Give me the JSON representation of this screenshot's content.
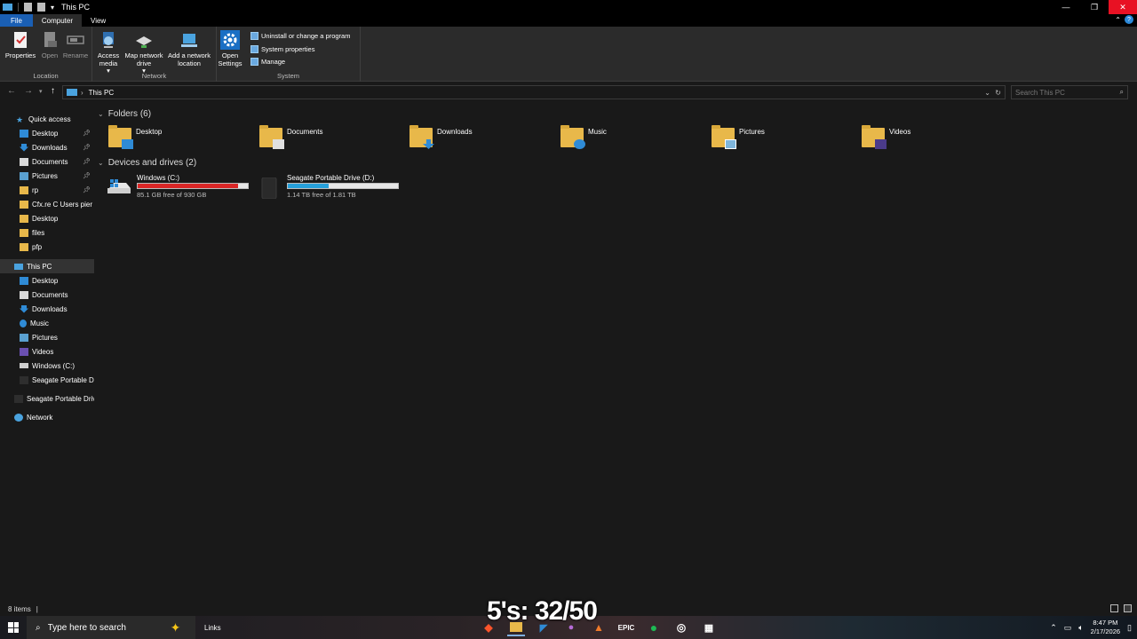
{
  "window": {
    "title": "This PC"
  },
  "tabs": {
    "file": "File",
    "computer": "Computer",
    "view": "View"
  },
  "ribbon": {
    "location": {
      "label": "Location",
      "properties": "Properties",
      "open": "Open",
      "rename": "Rename"
    },
    "network": {
      "label": "Network",
      "access_media": "Access media",
      "map_network_drive": "Map network drive",
      "add_network_location": "Add a network location"
    },
    "system": {
      "label": "System",
      "open_settings": "Open Settings",
      "uninstall": "Uninstall or change a program",
      "system_properties": "System properties",
      "manage": "Manage"
    }
  },
  "address": {
    "path": "This PC",
    "search_placeholder": "Search This PC"
  },
  "navpane": {
    "quick_access": "Quick access",
    "quick_items": [
      "Desktop",
      "Downloads",
      "Documents",
      "Pictures",
      "rp",
      "Cfx.re  C  Users pier",
      "Desktop",
      "files",
      "pfp"
    ],
    "this_pc": "This PC",
    "pc_items": [
      "Desktop",
      "Documents",
      "Downloads",
      "Music",
      "Pictures",
      "Videos",
      "Windows (C:)",
      "Seagate Portable Dr"
    ],
    "seagate": "Seagate Portable Drive",
    "network": "Network"
  },
  "main": {
    "folders_header": "Folders (6)",
    "folders": [
      "Desktop",
      "Documents",
      "Downloads",
      "Music",
      "Pictures",
      "Videos"
    ],
    "drives_header": "Devices and drives (2)",
    "drives": [
      {
        "name": "Windows (C:)",
        "free": "85.1 GB free of 930 GB",
        "used_fraction": 0.9085,
        "bar_color": "#da2626"
      },
      {
        "name": "Seagate Portable Drive (D:)",
        "free": "1.14 TB free of 1.81 TB",
        "used_fraction": 0.37,
        "bar_color": "#26a0da"
      }
    ]
  },
  "status": {
    "items": "8 items"
  },
  "taskbar": {
    "search_placeholder": "Type here to search",
    "links": "Links",
    "overlay": "5's: 32/50",
    "epic": "EPIC",
    "time": "8:47 PM",
    "date": "2/17/2026"
  }
}
